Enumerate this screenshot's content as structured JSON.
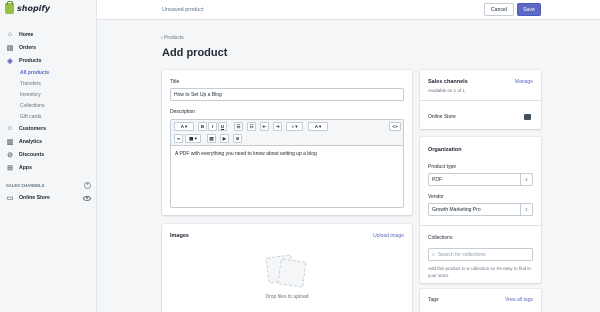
{
  "app": {
    "logo_text": "shopify"
  },
  "header": {
    "status": "Unsaved product",
    "cancel_label": "Cancel",
    "save_label": "Save"
  },
  "sidebar": {
    "items": [
      {
        "label": "Home"
      },
      {
        "label": "Orders"
      },
      {
        "label": "Products"
      }
    ],
    "product_subs": [
      {
        "label": "All products",
        "active": true
      },
      {
        "label": "Transfers"
      },
      {
        "label": "Inventory"
      },
      {
        "label": "Collections"
      },
      {
        "label": "Gift cards"
      }
    ],
    "items2": [
      {
        "label": "Customers"
      },
      {
        "label": "Analytics"
      },
      {
        "label": "Discounts"
      },
      {
        "label": "Apps"
      }
    ],
    "sales_channels_label": "SALES CHANNELS",
    "online_store_label": "Online Store"
  },
  "page": {
    "breadcrumb": "Products",
    "title": "Add product"
  },
  "main_card": {
    "title_label": "Title",
    "title_value": "How to Set Up a Blog",
    "description_label": "Description",
    "description_text": "A PDF with everything you need to know about setting up a blog"
  },
  "toolbar": {
    "bold": "B",
    "italic": "I",
    "underline": "U",
    "code": "<>"
  },
  "images_card": {
    "title": "Images",
    "upload_link": "Upload image",
    "drop_text": "Drop files to upload"
  },
  "sales_card": {
    "title": "Sales channels",
    "manage": "Manage",
    "availability": "Available on 1 of 1",
    "online_store": "Online Store"
  },
  "org_card": {
    "title": "Organization",
    "product_type_label": "Product type",
    "product_type_value": "PDF",
    "vendor_label": "Vendor",
    "vendor_value": "Growth Marketing Pro",
    "collections_label": "Collections",
    "collections_placeholder": "Search for collections",
    "collections_help": "Add this product to a collection so it's easy to find in your store."
  },
  "tags_card": {
    "title": "Tags",
    "view_all": "View all tags"
  },
  "colors": {
    "accent": "#5c6ac4",
    "brand_green": "#95bf47"
  }
}
